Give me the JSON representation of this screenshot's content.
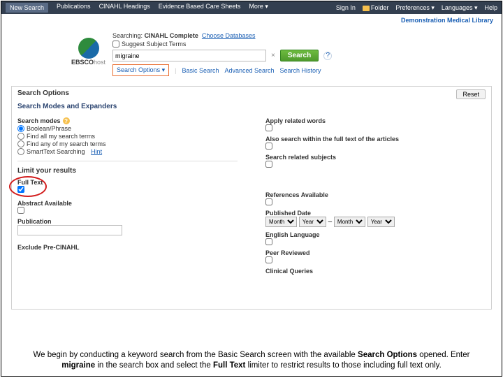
{
  "topnav": {
    "new_search": "New Search",
    "publications": "Publications",
    "cinahl_headings": "CINAHL Headings",
    "ebc_sheets": "Evidence Based Care Sheets",
    "more": "More ▾",
    "signin": "Sign In",
    "folder": "Folder",
    "preferences": "Preferences ▾",
    "languages": "Languages ▾",
    "help": "Help"
  },
  "subnav": {
    "demo_link": "Demonstration Medical Library"
  },
  "logo": {
    "line1": "EBSCO",
    "line2": "host"
  },
  "search_area": {
    "searching_prefix": "Searching: ",
    "db_name": "CINAHL Complete",
    "choose_db": "Choose Databases",
    "suggest": "Suggest Subject Terms",
    "input_value": "migraine",
    "search_btn": "Search",
    "options": "Search Options",
    "basic": "Basic Search",
    "advanced": "Advanced Search",
    "history": "Search History"
  },
  "panel": {
    "title": "Search Options",
    "reset": "Reset",
    "modes_head": "Search Modes and Expanders",
    "left": {
      "search_modes": "Search modes",
      "m1": "Boolean/Phrase",
      "m2": "Find all my search terms",
      "m3": "Find any of my search terms",
      "m4": "SmartText Searching",
      "hint": "Hint",
      "limit_head": "Limit your results",
      "full_text": "Full Text",
      "abstract": "Abstract Available",
      "publication": "Publication",
      "exclude_pre": "Exclude Pre-CINAHL"
    },
    "right": {
      "apply_related": "Apply related words",
      "also_fulltext": "Also search within the full text of the articles",
      "related_subj": "Search related subjects",
      "refs_avail": "References Available",
      "pub_date": "Published Date",
      "month": "Month",
      "year": "Year",
      "dash": "–",
      "eng": "English Language",
      "peer": "Peer Reviewed",
      "clinq": "Clinical Queries"
    }
  },
  "caption": {
    "t1": "We begin by conducting a keyword search from the Basic Search screen with the available ",
    "t2": "Search Options",
    "t3": " opened. Enter ",
    "t4": "migraine",
    "t5": " in the search box and select the ",
    "t6": "Full Text",
    "t7": " limiter to restrict results to those including full text only."
  }
}
